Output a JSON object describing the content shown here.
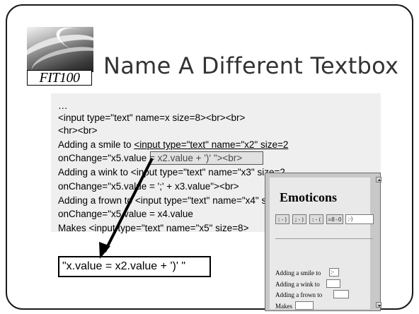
{
  "logo": {
    "text": "FIT100"
  },
  "slide": {
    "title": "Name A Different Textbox"
  },
  "code": {
    "lines": [
      "…",
      "<input type=\"text\" name=x  size=8><br><br>",
      "   <hr><br>",
      "Adding a smile to ",
      "<input type=\"text\" name=\"x2\" size=2",
      "       onChange=\"",
      "x5.value = x2.value + ')' \"",
      "><br>",
      "Adding a wink to <input type=\"text\" name=\"x3\" size=2",
      "       onChange=\"x5.value = ';' + x3.value\"><br>",
      "Adding a frown to <input type=\"text\" name=\"x4\" size=2",
      "       onChange=\"x5.value = x4.value",
      "Makes <input type=\"text\" name=\"x5\"  size=8>"
    ]
  },
  "callout": {
    "text": "\"x.value = x2.value + ')' \""
  },
  "emoticons": {
    "title": "Emoticons",
    "buttons": [
      ":-)",
      ";-)",
      ":-(",
      "=8-O"
    ],
    "output_value": ";-)",
    "rows": [
      {
        "label": "Adding a smile to",
        "value": ":-"
      },
      {
        "label": "Adding a wink to",
        "value": ""
      },
      {
        "label": "Adding a frown to",
        "value": ""
      },
      {
        "label": "Makes",
        "value": ""
      }
    ]
  }
}
